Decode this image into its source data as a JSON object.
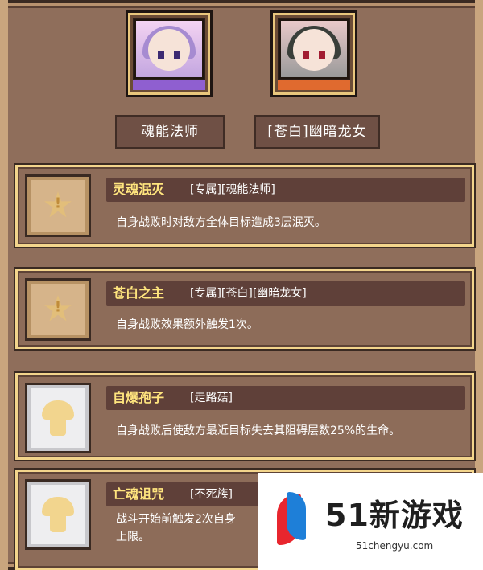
{
  "characters": [
    {
      "name": "魂能法师",
      "bar_color": "#8f5fd0"
    },
    {
      "name": "[苍白]幽暗龙女",
      "bar_color": "#e06a2f"
    }
  ],
  "skills": [
    {
      "name": "灵魂泯灭",
      "tags": "[专属][魂能法师]",
      "description": "自身战败时对敌方全体目标造成3层泯灭。",
      "icon": "star-icon"
    },
    {
      "name": "苍白之主",
      "tags": "[专属][苍白][幽暗龙女]",
      "description": "自身战败效果额外触发1次。",
      "icon": "star-icon"
    },
    {
      "name": "自爆孢子",
      "tags": "[走路菇]",
      "description": "自身战败后使敌方最近目标失去其阻碍层数25%的生命。",
      "icon": "mushroom-icon"
    },
    {
      "name": "亡魂诅咒",
      "tags": "[不死族]",
      "description": "战斗开始前触发2次自身",
      "description_line2": "上限。",
      "icon": "mushroom-icon"
    }
  ],
  "watermark": {
    "brand": "51新游戏",
    "url": "51chengyu.com"
  },
  "colors": {
    "skill_name": "#ffe57e",
    "card_border": "#f3d58c",
    "panel": "#8d6c59"
  }
}
